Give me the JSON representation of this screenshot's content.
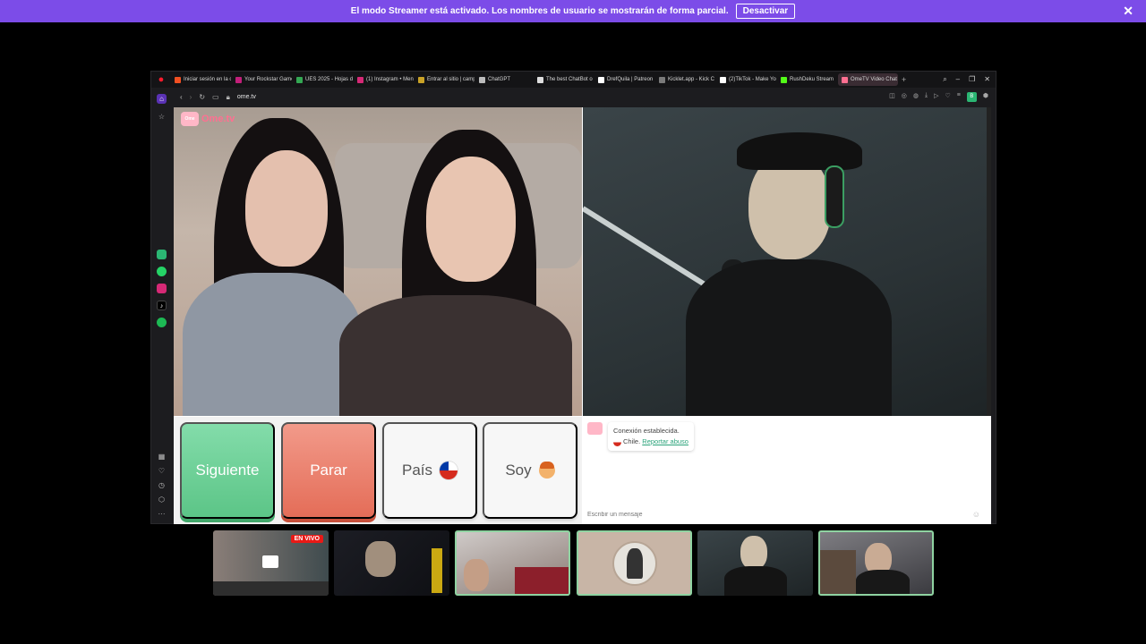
{
  "banner": {
    "message": "El modo Streamer está activado. Los nombres de usuario se mostrarán de forma parcial.",
    "button": "Desactivar",
    "close": "✕"
  },
  "browser": {
    "tabs": [
      {
        "label": "Iniciar sesión en la c",
        "color": "#f25022"
      },
      {
        "label": "Your Rockstar Game",
        "color": "#c21f7a"
      },
      {
        "label": "UES 2025 - Hojas de",
        "color": "#34a853"
      },
      {
        "label": "(1) Instagram • Mens",
        "color": "#d62976"
      },
      {
        "label": "Entrar al sitio | camp",
        "color": "#c9a227"
      },
      {
        "label": "ChatGPT",
        "color": "#bbbbbb"
      },
      {
        "label": "The best ChatBot o",
        "color": "#dddddd"
      },
      {
        "label": "DrefQuila | Patreon",
        "color": "#ffffff"
      },
      {
        "label": "Kicklet.app - Kick C",
        "color": "#7a7a7a"
      },
      {
        "label": "(2)TikTok - Make Yo",
        "color": "#ffffff"
      },
      {
        "label": "RushDeku Stream",
        "color": "#53fc18"
      },
      {
        "label": "OmeTV Video Chat",
        "color": "#ff6f91"
      }
    ],
    "url": "ome.tv",
    "extension_badge": "B"
  },
  "site": {
    "logo": "Ome.tv",
    "buttons": {
      "next": "Siguiente",
      "stop": "Parar",
      "country": "País",
      "me": "Soy"
    },
    "chat": {
      "status": "Conexión establecida.",
      "country": "Chile.",
      "report": "Reportar abuso",
      "placeholder": "Escribir un mensaje"
    }
  },
  "stream": {
    "live_badge": "EN VIVO"
  },
  "colors": {
    "banner": "#7c4ce8",
    "next_button": "#5cc587",
    "stop_button": "#e46d58",
    "accent_link": "#2aa37a"
  }
}
